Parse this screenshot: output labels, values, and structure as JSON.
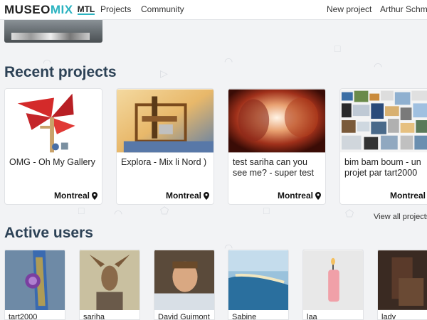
{
  "nav": {
    "logo_part1": "MUSEO",
    "logo_part2": "MIX",
    "logo_part3": "MTL",
    "projects": "Projects",
    "community": "Community",
    "new_project": "New project",
    "user": "Arthur Schmitt"
  },
  "recent": {
    "heading": "Recent projects",
    "view_all": "View all projects",
    "cards": [
      {
        "title": "OMG - Oh My Gallery",
        "location": "Montreal"
      },
      {
        "title": "Explora - Mix li Nord )",
        "location": "Montreal"
      },
      {
        "title": "test sariha can you see me? - super test",
        "location": "Montreal"
      },
      {
        "title": "bim bam boum - un projet par tart2000",
        "location": "Montreal"
      }
    ]
  },
  "users": {
    "heading": "Active users",
    "list": [
      {
        "name": "tart2000"
      },
      {
        "name": "sariha"
      },
      {
        "name": "David Guimont"
      },
      {
        "name": "Sabine"
      },
      {
        "name": "laa"
      },
      {
        "name": "lady"
      }
    ]
  },
  "colors": {
    "accent": "#2bb3c0",
    "heading": "#2d4256",
    "background": "#f2f3f5"
  }
}
